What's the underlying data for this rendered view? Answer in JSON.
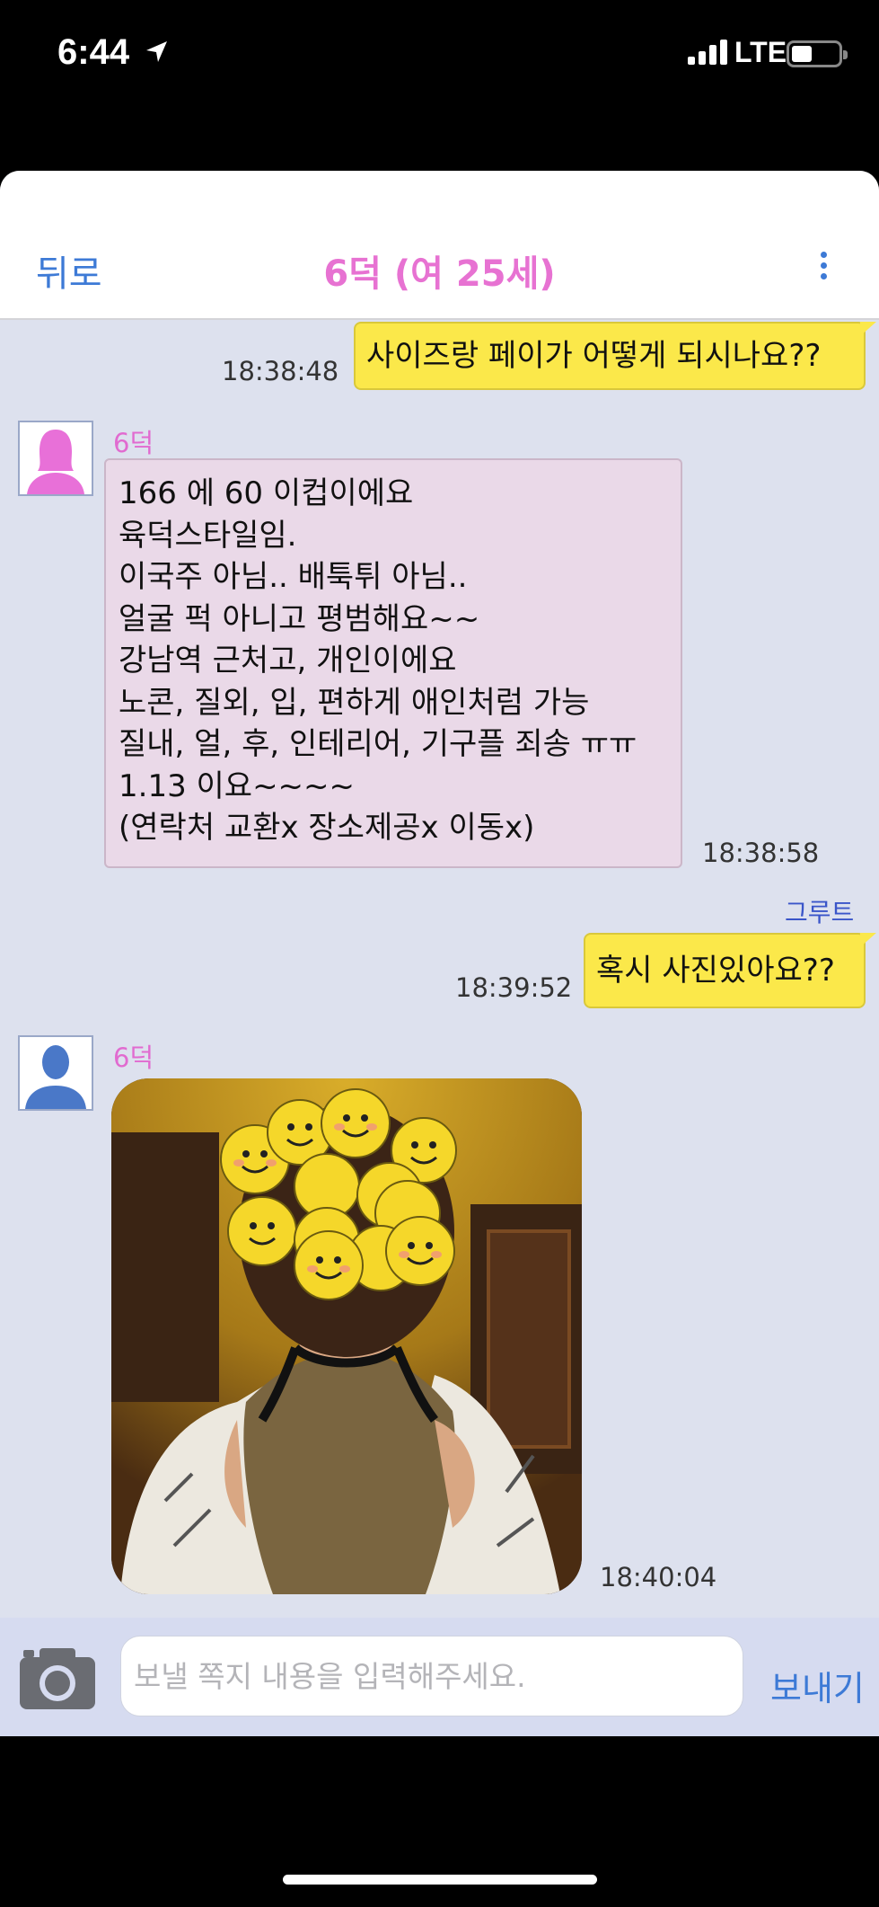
{
  "status_bar": {
    "time": "6:44",
    "network": "LTE"
  },
  "nav": {
    "back_label": "뒤로",
    "title": "6덕 (여 25세)"
  },
  "messages": [
    {
      "direction": "out",
      "text": "사이즈랑 페이가 어떻게 되시나요??",
      "time": "18:38:48"
    },
    {
      "direction": "in",
      "sender": "6덕",
      "lines": [
        "166 에 60 이컵이에요",
        "육덕스타일임.",
        "이국주 아님.. 배툭튀 아님..",
        "얼굴 퍽 아니고 평범해요~~",
        "강남역 근처고, 개인이에요",
        "노콘, 질외, 입, 편하게 애인처럼 가능",
        "질내, 얼, 후, 인테리어, 기구플 죄송 ㅠㅠ",
        "1.13 이요~~~~",
        "(연락처 교환x 장소제공x 이동x)"
      ],
      "time": "18:38:58"
    },
    {
      "direction": "out",
      "read_label": "그루트",
      "text": "혹시 사진있아요??",
      "time": "18:39:52"
    },
    {
      "direction": "in",
      "sender": "6덕",
      "type": "photo",
      "time": "18:40:04"
    }
  ],
  "composer": {
    "placeholder": "보낼 쪽지 내용을 입력해주세요.",
    "send_label": "보내기"
  },
  "colors": {
    "accent_blue": "#3d7ad6",
    "title_pink": "#e772d2",
    "outgoing_bubble": "#fbe84a",
    "incoming_bubble": "#ead9e8",
    "chat_background": "#dde1ee"
  },
  "icons": [
    "location-arrow-icon",
    "signal-icon",
    "battery-icon",
    "more-vertical-icon",
    "female-avatar-icon",
    "male-avatar-icon",
    "camera-icon"
  ]
}
